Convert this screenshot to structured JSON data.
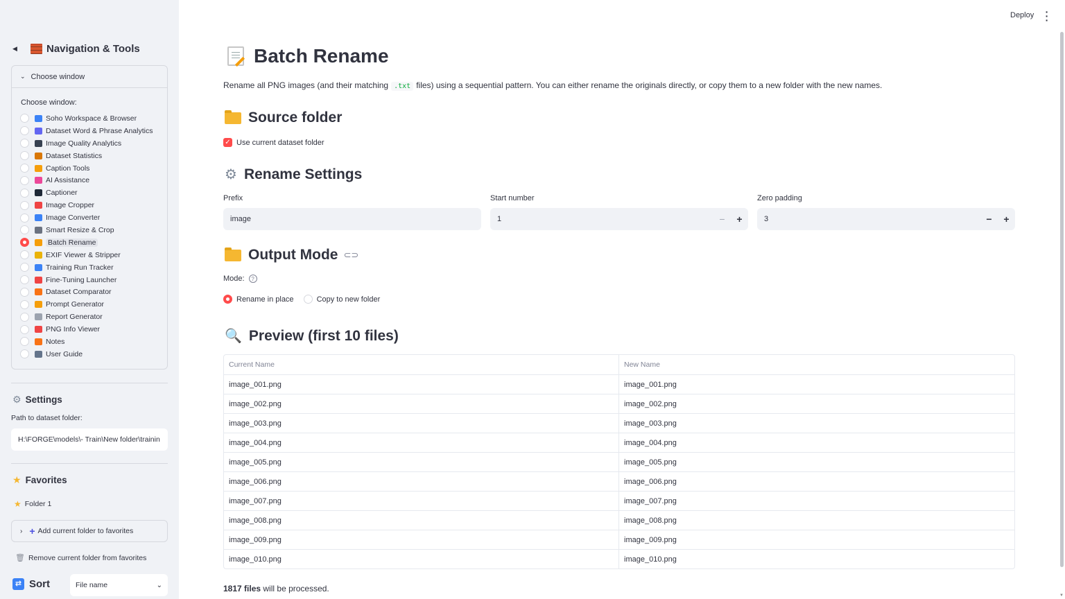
{
  "header": {
    "deploy_label": "Deploy",
    "menu_icon": "kebab-icon"
  },
  "sidebar": {
    "title": "Navigation & Tools",
    "expander_label": "Choose window",
    "radio_label": "Choose window:",
    "windows": [
      {
        "label": "Soho Workspace & Browser",
        "color": "#3b82f6"
      },
      {
        "label": "Dataset Word & Phrase Analytics",
        "color": "#6366f1"
      },
      {
        "label": "Image Quality Analytics",
        "color": "#374151"
      },
      {
        "label": "Dataset Statistics",
        "color": "#d97706"
      },
      {
        "label": "Caption Tools",
        "color": "#f59e0b"
      },
      {
        "label": "AI Assistance",
        "color": "#ec4899"
      },
      {
        "label": "Captioner",
        "color": "#1f2937"
      },
      {
        "label": "Image Cropper",
        "color": "#ef4444"
      },
      {
        "label": "Image Converter",
        "color": "#3b82f6"
      },
      {
        "label": "Smart Resize & Crop",
        "color": "#6b7280"
      },
      {
        "label": "Batch Rename",
        "color": "#f59e0b"
      },
      {
        "label": "EXIF Viewer & Stripper",
        "color": "#eab308"
      },
      {
        "label": "Training Run Tracker",
        "color": "#3b82f6"
      },
      {
        "label": "Fine-Tuning Launcher",
        "color": "#ef4444"
      },
      {
        "label": "Dataset Comparator",
        "color": "#f97316"
      },
      {
        "label": "Prompt Generator",
        "color": "#f59e0b"
      },
      {
        "label": "Report Generator",
        "color": "#9ca3af"
      },
      {
        "label": "PNG Info Viewer",
        "color": "#ef4444"
      },
      {
        "label": "Notes",
        "color": "#f97316"
      },
      {
        "label": "User Guide",
        "color": "#64748b"
      }
    ],
    "selected_window": "Batch Rename",
    "settings_title": "Settings",
    "path_label": "Path to dataset folder:",
    "path_value": "H:\\FORGE\\models\\- Train\\New folder\\trainin",
    "favorites_title": "Favorites",
    "favorite_item": "Folder 1",
    "add_favorite_label": "Add current folder to favorites",
    "remove_favorite_label": "Remove current folder from favorites",
    "sort_title": "Sort",
    "sort_value": "File name"
  },
  "main": {
    "title": "Batch Rename",
    "desc_before": "Rename all PNG images (and their matching",
    "desc_code": ".txt",
    "desc_after": "files) using a sequential pattern. You can either rename the originals directly, or copy them to a new folder with the new names.",
    "source_title": "Source folder",
    "use_current_label": "Use current dataset folder",
    "use_current_checked": true,
    "settings_title": "Rename Settings",
    "prefix_label": "Prefix",
    "prefix_value": "image",
    "start_label": "Start number",
    "start_value": "1",
    "padding_label": "Zero padding",
    "padding_value": "3",
    "output_title": "Output Mode",
    "mode_label": "Mode:",
    "mode_options": [
      "Rename in place",
      "Copy to new folder"
    ],
    "mode_selected": "Rename in place",
    "preview_title": "Preview (first 10 files)",
    "table_headers": [
      "Current Name",
      "New Name"
    ],
    "table_rows": [
      [
        "image_001.png",
        "image_001.png"
      ],
      [
        "image_002.png",
        "image_002.png"
      ],
      [
        "image_003.png",
        "image_003.png"
      ],
      [
        "image_004.png",
        "image_004.png"
      ],
      [
        "image_005.png",
        "image_005.png"
      ],
      [
        "image_006.png",
        "image_006.png"
      ],
      [
        "image_007.png",
        "image_007.png"
      ],
      [
        "image_008.png",
        "image_008.png"
      ],
      [
        "image_009.png",
        "image_009.png"
      ],
      [
        "image_010.png",
        "image_010.png"
      ]
    ],
    "file_count": "1817 files",
    "file_count_suffix": "will be processed."
  }
}
